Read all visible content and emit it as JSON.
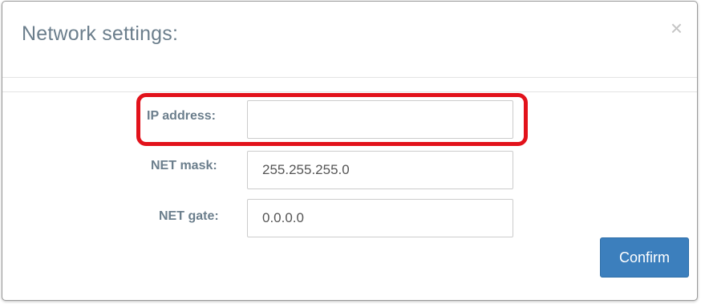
{
  "dialog": {
    "title": "Network settings:",
    "close_glyph": "×"
  },
  "form": {
    "ip_address": {
      "label": "IP address:",
      "value": ""
    },
    "net_mask": {
      "label": "NET mask:",
      "value": "255.255.255.0"
    },
    "net_gate": {
      "label": "NET gate:",
      "value": "0.0.0.0"
    }
  },
  "actions": {
    "confirm_label": "Confirm"
  },
  "colors": {
    "highlight": "#e2121b",
    "primary_button": "#3c7fbd",
    "label_text": "#6b7e8c"
  }
}
